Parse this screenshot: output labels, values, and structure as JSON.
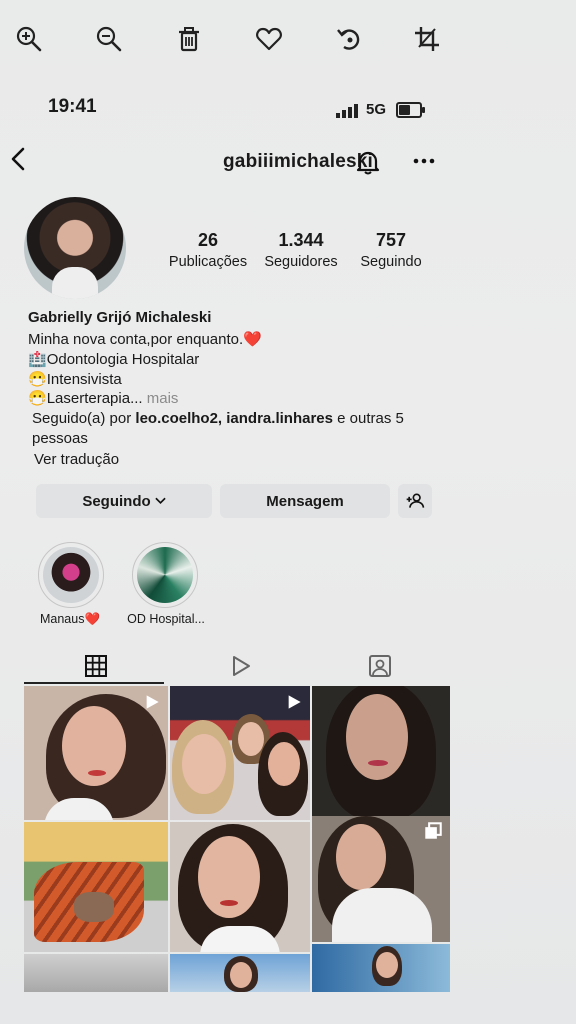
{
  "viewer_toolbar": {
    "icons": [
      "zoom-in-icon",
      "zoom-out-icon",
      "trash-icon",
      "heart-icon",
      "rotate-icon",
      "crop-icon"
    ]
  },
  "status_bar": {
    "time": "19:41",
    "network": "5G",
    "battery_level": 0.6
  },
  "header": {
    "username": "gabiiimichaleski"
  },
  "stats": [
    {
      "value": "26",
      "label": "Publicações"
    },
    {
      "value": "1.344",
      "label": "Seguidores"
    },
    {
      "value": "757",
      "label": "Seguindo"
    }
  ],
  "bio": {
    "name": "Gabrielly Grijó Michaleski",
    "line1": "Minha nova conta,por enquanto.",
    "line1_emoji": "❤️",
    "line2_emoji": "🏥",
    "line2": "Odontologia Hospitalar",
    "line3_emoji": "😷",
    "line3": "Intensivista",
    "line4_emoji": "😷",
    "line4": "Laserterapia...",
    "more": "mais",
    "followed_prefix": "Seguido(a) por ",
    "followed_names": "leo.coelho2, iandra.linhares",
    "followed_suffix": " e outras 5",
    "followed_suffix2": "pessoas",
    "translate": "Ver tradução"
  },
  "actions": {
    "following": "Seguindo",
    "message": "Mensagem"
  },
  "highlights": [
    {
      "label": "Manaus❤️"
    },
    {
      "label": "OD Hospital..."
    }
  ],
  "colors": {
    "accent_red": "#d9273a",
    "button_bg": "#e1e2e3"
  }
}
